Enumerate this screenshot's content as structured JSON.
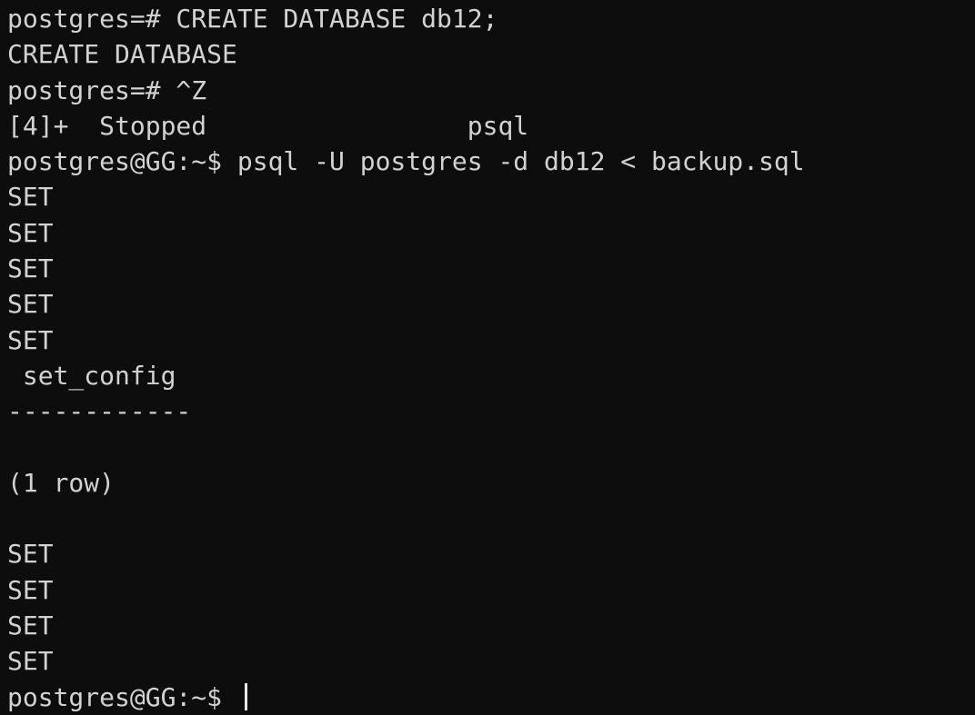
{
  "terminal": {
    "title": "postgres@GG terminal",
    "background_color": "#0d0d0d",
    "foreground_color": "#d2d2d2",
    "cursor_color": "#e8e8e8",
    "cursor_style": "vertical-bar",
    "columns": 55,
    "rows": 20,
    "lines": [
      "postgres=# CREATE DATABASE db12;",
      "CREATE DATABASE",
      "postgres=# ^Z",
      "[4]+  Stopped                 psql",
      "postgres@GG:~$ psql -U postgres -d db12 < backup.sql",
      "SET",
      "SET",
      "SET",
      "SET",
      "SET",
      " set_config",
      "------------",
      "",
      "(1 row)",
      "",
      "SET",
      "SET",
      "SET",
      "SET",
      "postgres@GG:~$ "
    ]
  }
}
